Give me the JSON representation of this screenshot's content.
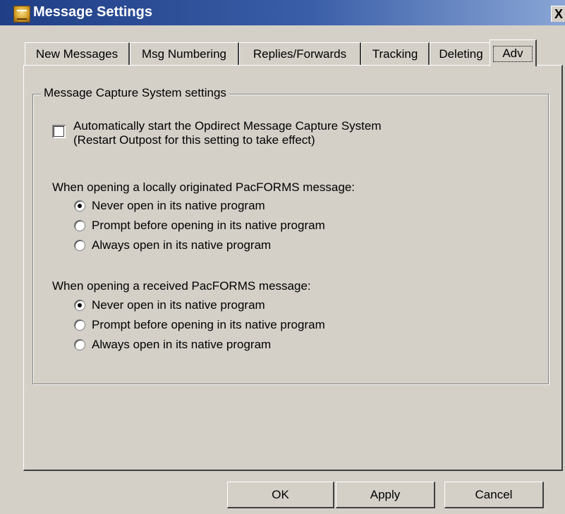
{
  "window": {
    "title": "Message Settings",
    "close_label": "X"
  },
  "tabs": [
    {
      "label": "New Messages",
      "active": false
    },
    {
      "label": "Msg Numbering",
      "active": false
    },
    {
      "label": "Replies/Forwards",
      "active": false
    },
    {
      "label": "Tracking",
      "active": false
    },
    {
      "label": "Deleting",
      "active": false
    },
    {
      "label": "Adv",
      "active": true
    }
  ],
  "group": {
    "title": "Message Capture System settings",
    "auto_start": {
      "checked": false,
      "line1": "Automatically start the Opdirect Message Capture System",
      "line2": "(Restart Outpost for this setting to take effect)"
    }
  },
  "local_section": {
    "label": "When opening a locally originated PacFORMS message:",
    "options": [
      {
        "label": "Never open in its native program",
        "checked": true
      },
      {
        "label": "Prompt before opening in its native program",
        "checked": false
      },
      {
        "label": "Always open in its native program",
        "checked": false
      }
    ]
  },
  "received_section": {
    "label": "When opening a received PacFORMS message:",
    "options": [
      {
        "label": "Never open in its native program",
        "checked": true
      },
      {
        "label": "Prompt before opening in its native program",
        "checked": false
      },
      {
        "label": "Always open in its native program",
        "checked": false
      }
    ]
  },
  "buttons": {
    "ok": "OK",
    "apply": "Apply",
    "cancel": "Cancel"
  }
}
